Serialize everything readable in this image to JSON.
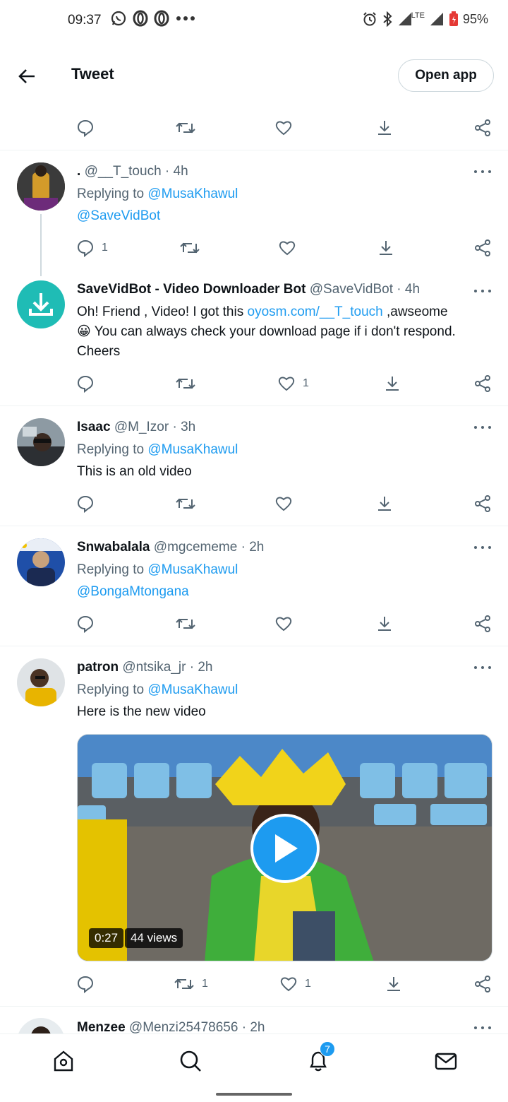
{
  "status_bar": {
    "time": "09:37",
    "battery": "95%",
    "network": "LTE",
    "left_icons": [
      "whatsapp-icon",
      "opera-icon",
      "opera-icon",
      "more-dots-icon"
    ],
    "right_icons": [
      "alarm-icon",
      "bluetooth-icon",
      "signal-icon",
      "signal-icon",
      "battery-icon"
    ]
  },
  "header": {
    "title": "Tweet",
    "open_app_label": "Open app"
  },
  "prev_tweet_actions": {
    "reply_count": "",
    "retweet_count": "",
    "like_count": ""
  },
  "tweets": [
    {
      "name": ".",
      "handle": "@__T_touch",
      "time": "4h",
      "replying_to_label": "Replying to",
      "replying_to": "@MusaKhawul",
      "text_mention": "@SaveVidBot",
      "reply_count": "1",
      "retweet_count": "",
      "like_count": ""
    },
    {
      "name": "SaveVidBot - Video Downloader Bot",
      "handle": "@SaveVidBot",
      "time": "4h",
      "text_1": "Oh! Friend , Video! I got this ",
      "link": "oyosm.com/__T_touch",
      "text_2": " ,awseome",
      "emoji": "😀",
      "text_3": " You can always check your download page if i don't respond. Cheers",
      "reply_count": "",
      "retweet_count": "",
      "like_count": "1"
    },
    {
      "name": "Isaac",
      "handle": "@M_Izor",
      "time": "3h",
      "replying_to_label": "Replying to",
      "replying_to": "@MusaKhawul",
      "text": "This is an old video",
      "reply_count": "",
      "retweet_count": "",
      "like_count": ""
    },
    {
      "name": "Snwabalala",
      "handle": "@mgcememe",
      "time": "2h",
      "replying_to_label": "Replying to",
      "replying_to": "@MusaKhawul",
      "text_mention": "@BongaMtongana",
      "reply_count": "",
      "retweet_count": "",
      "like_count": ""
    },
    {
      "name": "patron",
      "handle": "@ntsika_jr",
      "time": "2h",
      "replying_to_label": "Replying to",
      "replying_to": "@MusaKhawul",
      "text": "Here is the new video",
      "video_duration": "0:27",
      "video_views": "44 views",
      "reply_count": "",
      "retweet_count": "1",
      "like_count": "1"
    },
    {
      "name": "Menzee",
      "handle": "@Menzi25478656",
      "time": "2h"
    }
  ],
  "separator": " · ",
  "bottom_nav": {
    "items": [
      "home-icon",
      "search-icon",
      "notifications-icon",
      "messages-icon"
    ],
    "notification_count": "7"
  },
  "colors": {
    "accent": "#1d9bf0",
    "text_primary": "#0f1419",
    "text_secondary": "#536471",
    "divider": "#eff3f4"
  }
}
